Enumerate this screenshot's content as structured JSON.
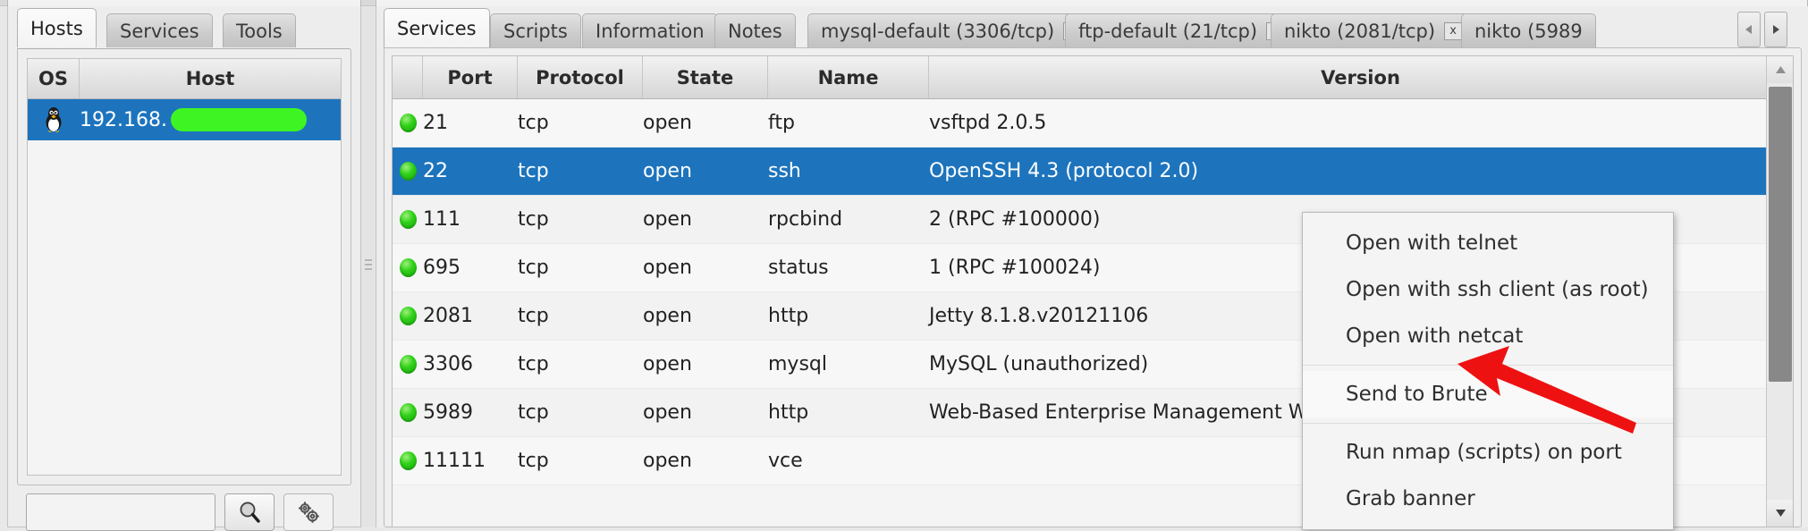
{
  "left_panel": {
    "tabs": [
      {
        "label": "Hosts",
        "active": true
      },
      {
        "label": "Services",
        "active": false
      },
      {
        "label": "Tools",
        "active": false
      }
    ],
    "host_table": {
      "columns": [
        "OS",
        "Host"
      ],
      "rows": [
        {
          "os_icon": "linux-penguin-icon",
          "host": "192.168.",
          "redacted": true,
          "selected": true
        }
      ]
    },
    "footer": {
      "search_value": "",
      "search_placeholder": "",
      "search_button_icon": "magnifier-icon",
      "settings_button_icon": "gears-icon"
    }
  },
  "right_panel": {
    "tabs": [
      {
        "label": "Services",
        "active": true,
        "closable": false
      },
      {
        "label": "Scripts",
        "active": false,
        "closable": false
      },
      {
        "label": "Information",
        "active": false,
        "closable": false
      },
      {
        "label": "Notes",
        "active": false,
        "closable": false
      },
      {
        "label": "mysql-default (3306/tcp)",
        "active": false,
        "closable": true
      },
      {
        "label": "ftp-default (21/tcp)",
        "active": false,
        "closable": true
      },
      {
        "label": "nikto (2081/tcp)",
        "active": false,
        "closable": true
      },
      {
        "label": "nikto (5989",
        "active": false,
        "closable": false
      }
    ],
    "tab_close_glyph": "x",
    "scroll_left_icon": "chevron-left-icon",
    "scroll_right_icon": "chevron-right-icon",
    "services_table": {
      "columns": [
        "Port",
        "Protocol",
        "State",
        "Name",
        "Version"
      ],
      "rows": [
        {
          "led": "green",
          "port": "21",
          "protocol": "tcp",
          "state": "open",
          "name": "ftp",
          "version": "vsftpd 2.0.5",
          "selected": false
        },
        {
          "led": "green",
          "port": "22",
          "protocol": "tcp",
          "state": "open",
          "name": "ssh",
          "version": "OpenSSH 4.3 (protocol 2.0)",
          "selected": true
        },
        {
          "led": "green",
          "port": "111",
          "protocol": "tcp",
          "state": "open",
          "name": "rpcbind",
          "version": "2 (RPC #100000)",
          "selected": false
        },
        {
          "led": "green",
          "port": "695",
          "protocol": "tcp",
          "state": "open",
          "name": "status",
          "version": "1 (RPC #100024)",
          "selected": false
        },
        {
          "led": "green",
          "port": "2081",
          "protocol": "tcp",
          "state": "open",
          "name": "http",
          "version": "Jetty 8.1.8.v20121106",
          "selected": false
        },
        {
          "led": "green",
          "port": "3306",
          "protocol": "tcp",
          "state": "open",
          "name": "mysql",
          "version": "MySQL (unauthorized)",
          "selected": false
        },
        {
          "led": "green",
          "port": "5989",
          "protocol": "tcp",
          "state": "open",
          "name": "http",
          "version": "Web-Based Enterprise Management WBEM...",
          "selected": false
        },
        {
          "led": "green",
          "port": "11111",
          "protocol": "tcp",
          "state": "open",
          "name": "vce",
          "version": "",
          "selected": false
        }
      ]
    },
    "scrollbar": {
      "up_icon": "scroll-up-arrow-icon",
      "down_icon": "scroll-down-arrow-icon"
    }
  },
  "context_menu": {
    "items": [
      {
        "label": "Open with telnet",
        "highlighted": false,
        "separator_after": false
      },
      {
        "label": "Open with ssh client (as root)",
        "highlighted": false,
        "separator_after": false
      },
      {
        "label": "Open with netcat",
        "highlighted": false,
        "separator_after": true
      },
      {
        "label": "Send to Brute",
        "highlighted": true,
        "separator_after": true
      },
      {
        "label": "Run nmap (scripts) on port",
        "highlighted": false,
        "separator_after": false
      },
      {
        "label": "Grab banner",
        "highlighted": false,
        "separator_after": false
      }
    ]
  },
  "annotation": {
    "arrow_icon": "red-arrow-pointer",
    "color": "#ee1111",
    "points_at": "Send to Brute"
  },
  "colors": {
    "selection_blue": "#1d74bd",
    "led_green": "#2fd018",
    "redaction_green": "#3ef523",
    "panel_gray": "#ededed",
    "arrow_red": "#ee1111"
  }
}
